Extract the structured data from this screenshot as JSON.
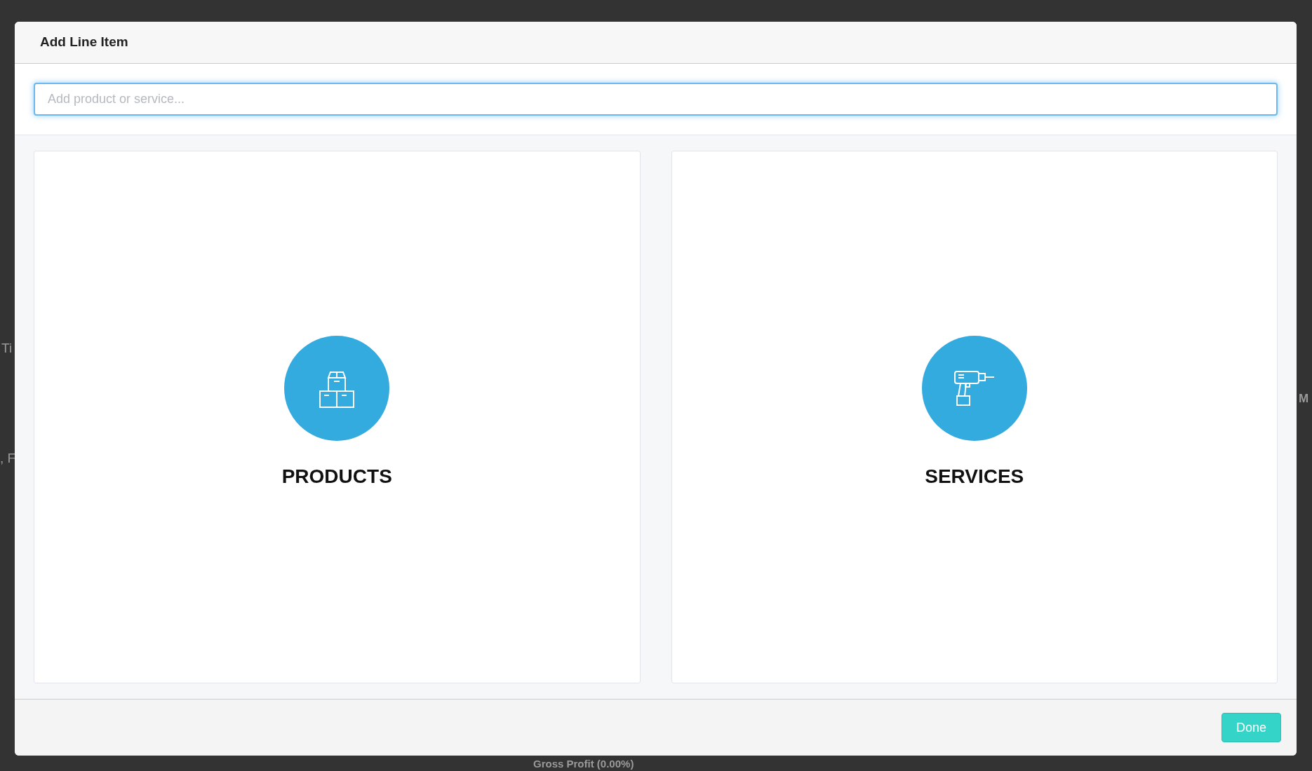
{
  "background": {
    "texts": [
      "Ti",
      ", F",
      "M",
      "Gross Profit (0.00%)"
    ]
  },
  "dialog": {
    "title": "Add Line Item",
    "search": {
      "placeholder": "Add product or service...",
      "focused": true
    },
    "options": [
      {
        "label": "PRODUCTS",
        "kind": "products"
      },
      {
        "label": "SERVICES",
        "kind": "services"
      }
    ],
    "buttons": [
      {
        "label": "Done"
      }
    ]
  }
}
